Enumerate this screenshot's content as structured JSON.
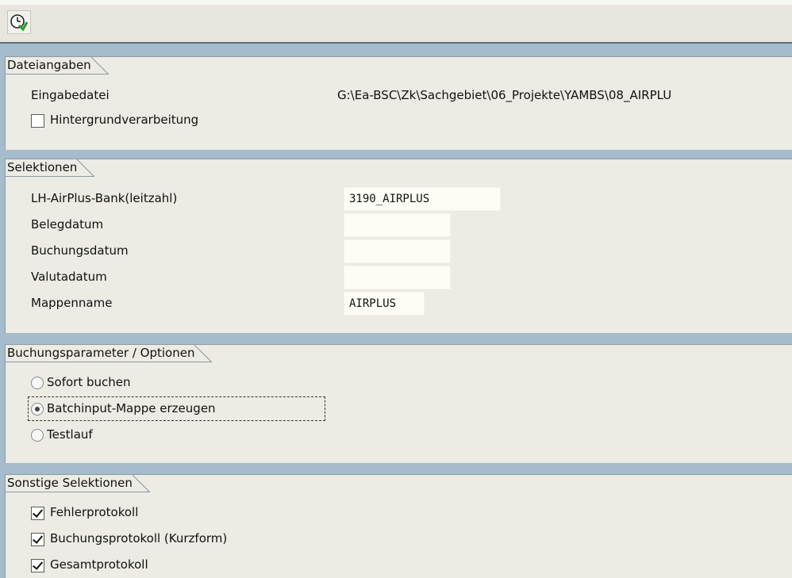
{
  "toolbar": {
    "execute_icon": "execute-clock-icon"
  },
  "sections": {
    "dateiangaben": {
      "title": "Dateiangaben",
      "eingabedatei_label": "Eingabedatei",
      "eingabedatei_value": "G:\\Ea-BSC\\Zk\\Sachgebiet\\06_Projekte\\YAMBS\\08_AIRPLU",
      "hintergrund_label": "Hintergrundverarbeitung",
      "hintergrund_checked": false
    },
    "selektionen": {
      "title": "Selektionen",
      "bank_label": "LH-AirPlus-Bank(leitzahl)",
      "bank_value": "3190_AIRPLUS",
      "belegdatum_label": "Belegdatum",
      "belegdatum_value": "",
      "buchungsdatum_label": "Buchungsdatum",
      "buchungsdatum_value": "",
      "valutadatum_label": "Valutadatum",
      "valutadatum_value": "",
      "mappenname_label": "Mappenname",
      "mappenname_value": "AIRPLUS"
    },
    "buchungsparameter": {
      "title": "Buchungsparameter / Optionen",
      "options": [
        {
          "label": "Sofort buchen",
          "selected": false
        },
        {
          "label": "Batchinput-Mappe erzeugen",
          "selected": true
        },
        {
          "label": "Testlauf",
          "selected": false
        }
      ]
    },
    "sonstige": {
      "title": "Sonstige Selektionen",
      "checkboxes": [
        {
          "label": "Fehlerprotokoll",
          "checked": true
        },
        {
          "label": "Buchungsprotokoll (Kurzform)",
          "checked": true
        },
        {
          "label": "Gesamtprotokoll",
          "checked": true
        }
      ]
    }
  },
  "colors": {
    "background": "#a5bccd",
    "panel": "#ecebe4",
    "input": "#fdfdf6"
  }
}
